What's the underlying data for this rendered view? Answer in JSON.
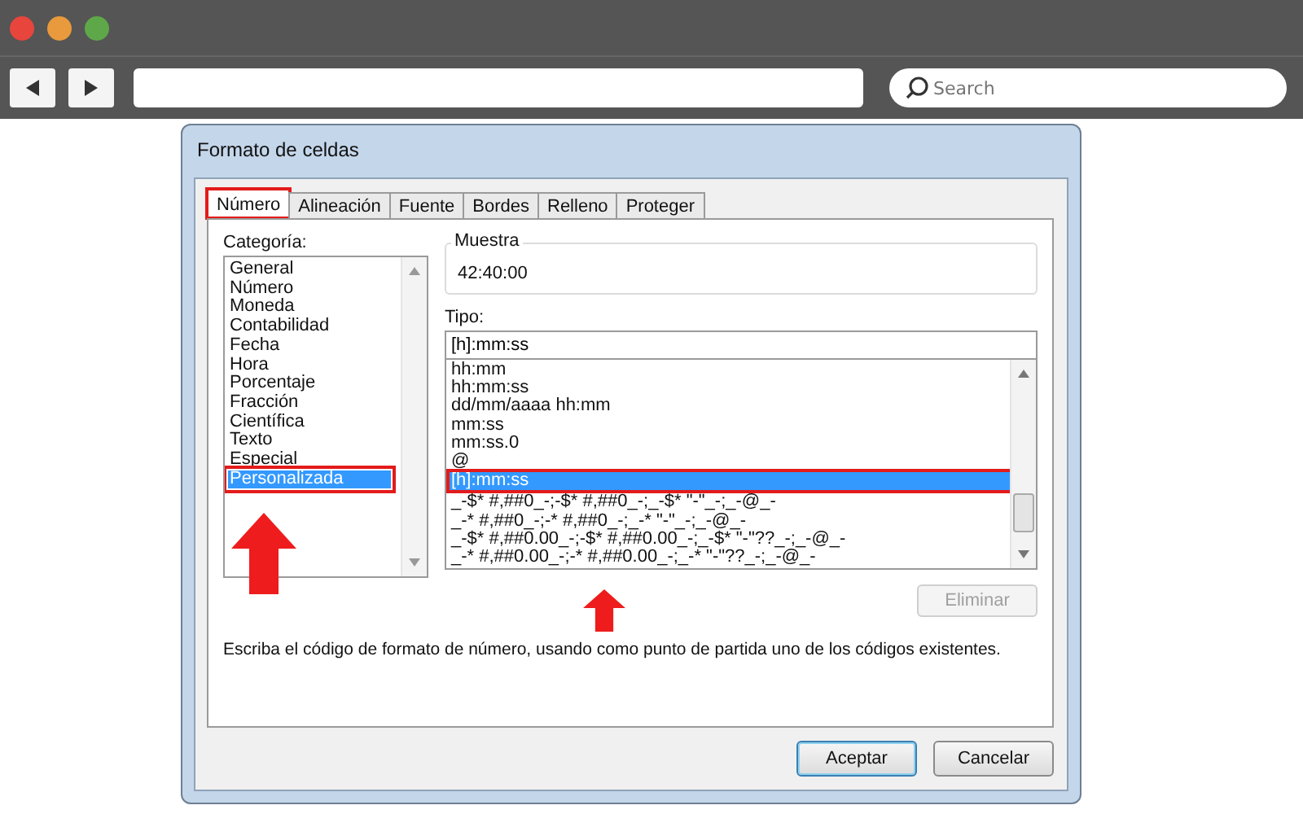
{
  "browser": {
    "search": {
      "placeholder": "Search"
    }
  },
  "dialog": {
    "title": "Formato de celdas",
    "tabs": [
      {
        "label": "Número",
        "selected": true
      },
      {
        "label": "Alineación",
        "selected": false
      },
      {
        "label": "Fuente",
        "selected": false
      },
      {
        "label": "Bordes",
        "selected": false
      },
      {
        "label": "Relleno",
        "selected": false
      },
      {
        "label": "Proteger",
        "selected": false
      }
    ],
    "category": {
      "label": "Categoría:",
      "items": [
        {
          "label": "General",
          "selected": false
        },
        {
          "label": "Número",
          "selected": false
        },
        {
          "label": "Moneda",
          "selected": false
        },
        {
          "label": "Contabilidad",
          "selected": false
        },
        {
          "label": "Fecha",
          "selected": false
        },
        {
          "label": "Hora",
          "selected": false
        },
        {
          "label": "Porcentaje",
          "selected": false
        },
        {
          "label": "Fracción",
          "selected": false
        },
        {
          "label": "Científica",
          "selected": false
        },
        {
          "label": "Texto",
          "selected": false
        },
        {
          "label": "Especial",
          "selected": false
        },
        {
          "label": "Personalizada",
          "selected": true
        }
      ]
    },
    "sample": {
      "label": "Muestra",
      "value": "42:40:00"
    },
    "type": {
      "label": "Tipo:",
      "value": "[h]:mm:ss",
      "items": [
        {
          "label": "hh:mm",
          "selected": false
        },
        {
          "label": "hh:mm:ss",
          "selected": false
        },
        {
          "label": "dd/mm/aaaa hh:mm",
          "selected": false
        },
        {
          "label": "mm:ss",
          "selected": false
        },
        {
          "label": "mm:ss.0",
          "selected": false
        },
        {
          "label": "@",
          "selected": false
        },
        {
          "label": "[h]:mm:ss",
          "selected": true
        },
        {
          "label": "_-$* #,##0_-;-$* #,##0_-;_-$* \"-\"_-;_-@_-",
          "selected": false
        },
        {
          "label": "_-* #,##0_-;-* #,##0_-;_-* \"-\"_-;_-@_-",
          "selected": false
        },
        {
          "label": "_-$* #,##0.00_-;-$* #,##0.00_-;_-$* \"-\"??_-;_-@_-",
          "selected": false
        },
        {
          "label": "_-* #,##0.00_-;-* #,##0.00_-;_-* \"-\"??_-;_-@_-",
          "selected": false
        }
      ]
    },
    "delete_button": {
      "label": "Eliminar",
      "disabled": true
    },
    "description": "Escriba el código de formato de número, usando como punto de partida uno de los códigos existentes.",
    "buttons": [
      {
        "label": "Aceptar",
        "kind": "default"
      },
      {
        "label": "Cancelar",
        "kind": "normal"
      }
    ]
  }
}
